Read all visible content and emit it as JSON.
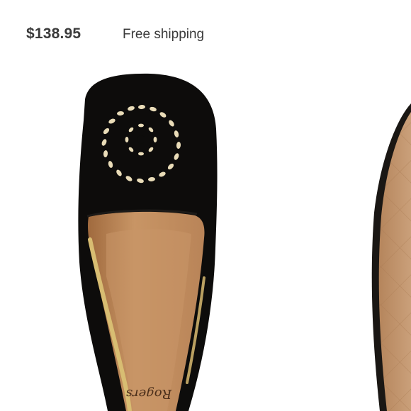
{
  "listing": {
    "price": "$138.95",
    "shipping": "Free shipping"
  },
  "product_image": {
    "insole_brand": "Rogers",
    "colors": {
      "suede": "#0d0c0b",
      "leather": "#b9865c",
      "gold_trim": "#d8bd72",
      "stitch": "#e9dcb8"
    }
  }
}
